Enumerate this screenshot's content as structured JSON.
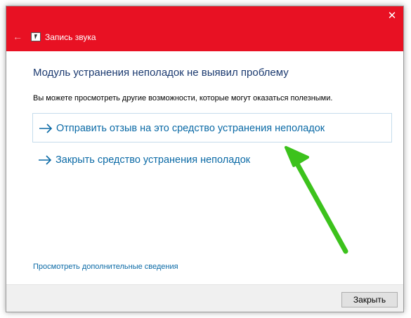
{
  "window": {
    "title": "Запись звука",
    "back_icon": "back-arrow-icon",
    "close_icon": "close-icon",
    "accent_color": "#e81123"
  },
  "main": {
    "heading": "Модуль устранения неполадок не выявил проблему",
    "subtext": "Вы можете просмотреть другие возможности, которые могут оказаться полезными.",
    "options": [
      {
        "label": "Отправить отзыв на это средство устранения неполадок",
        "icon": "arrow-right-icon"
      },
      {
        "label": "Закрыть средство устранения неполадок",
        "icon": "arrow-right-icon"
      }
    ],
    "more_info_link": "Просмотреть дополнительные сведения",
    "link_color": "#0b6aa6"
  },
  "footer": {
    "close_button": "Закрыть"
  },
  "annotation": {
    "arrow_color": "#3cc21c",
    "icon": "green-pointer-arrow"
  }
}
